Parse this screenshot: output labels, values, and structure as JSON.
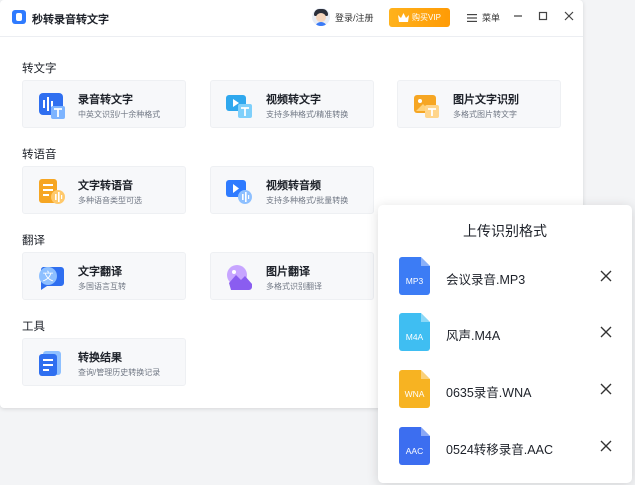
{
  "app": {
    "title": "秒转录音转文字"
  },
  "header": {
    "login_label": "登录/注册",
    "vip_label": "购买VIP",
    "menu_label": "菜单"
  },
  "sections": [
    {
      "title": "转文字",
      "cards": [
        {
          "title": "录音转文字",
          "subtitle": "中英文识别/十余种格式",
          "icon": "audio-to-text-icon"
        },
        {
          "title": "视频转文字",
          "subtitle": "支持多种格式/精准转换",
          "icon": "video-to-text-icon"
        },
        {
          "title": "图片文字识别",
          "subtitle": "多格式图片转文字",
          "icon": "image-ocr-icon"
        }
      ]
    },
    {
      "title": "转语音",
      "cards": [
        {
          "title": "文字转语音",
          "subtitle": "多种语音类型可选",
          "icon": "text-to-speech-icon"
        },
        {
          "title": "视频转音频",
          "subtitle": "支持多种格式/批量转换",
          "icon": "video-to-audio-icon"
        }
      ]
    },
    {
      "title": "翻译",
      "cards": [
        {
          "title": "文字翻译",
          "subtitle": "多国语言互转",
          "icon": "text-translate-icon"
        },
        {
          "title": "图片翻译",
          "subtitle": "多格式识别翻译",
          "icon": "image-translate-icon"
        }
      ]
    },
    {
      "title": "工具",
      "cards": [
        {
          "title": "转换结果",
          "subtitle": "查询/管理历史转换记录",
          "icon": "history-icon"
        }
      ]
    }
  ],
  "upload_panel": {
    "title": "上传识别格式",
    "files": [
      {
        "badge": "MP3",
        "name": "会议录音.MP3",
        "color": "#3c7cf5"
      },
      {
        "badge": "M4A",
        "name": "风声.M4A",
        "color": "#3fbef2"
      },
      {
        "badge": "WNA",
        "name": "0635录音.WNA",
        "color": "#f7b322"
      },
      {
        "badge": "AAC",
        "name": "0524转移录音.AAC",
        "color": "#3c6ef0"
      }
    ]
  },
  "colors": {
    "accent": "#2f7bff",
    "vip": "#ffa812",
    "card_bg": "#f7f8fa"
  }
}
